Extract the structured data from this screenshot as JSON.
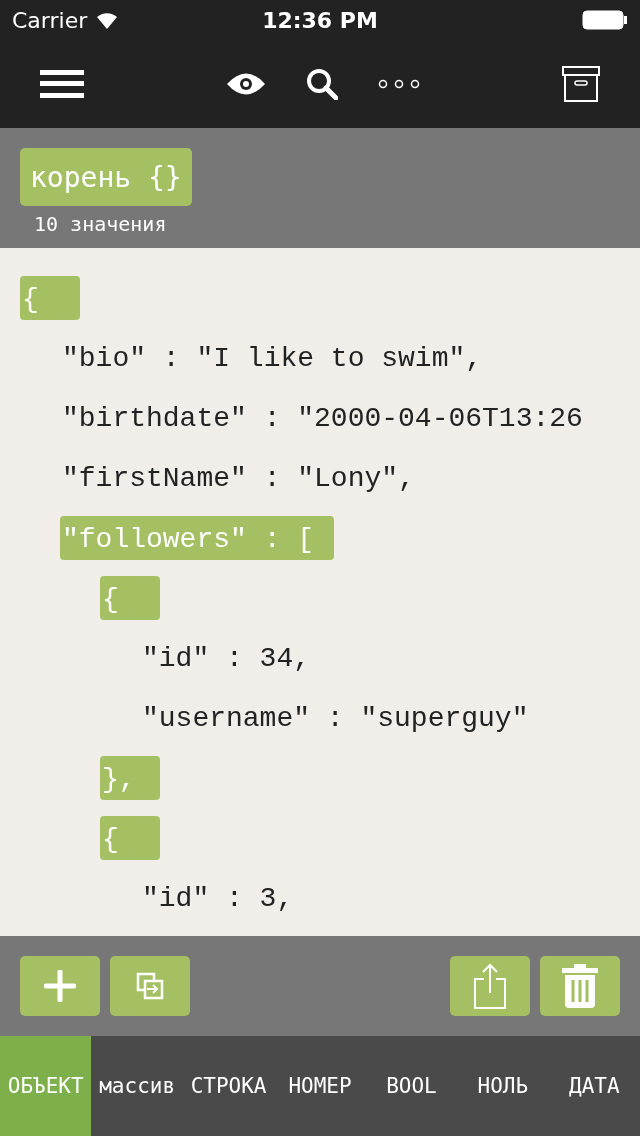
{
  "status_bar": {
    "carrier": "Carrier",
    "time": "12:36 PM"
  },
  "path": {
    "label": "корень {}",
    "count": "10 значения"
  },
  "lines": [
    {
      "text": "{",
      "selected": true,
      "children": [
        {
          "text": "\"bio\" : \"I like to swim\",",
          "selected": false
        },
        {
          "text": "\"birthdate\" : \"2000-04-06T13:26",
          "selected": false
        },
        {
          "text": "\"firstName\" : \"Lony\",",
          "selected": false
        },
        {
          "text": "\"followers\" : [",
          "selected": true,
          "children": [
            {
              "text": "{",
              "selected": true,
              "children": [
                {
                  "text": "\"id\" : 34,",
                  "selected": false
                },
                {
                  "text": "\"username\" : \"superguy\"",
                  "selected": false
                }
              ]
            },
            {
              "text": "},",
              "selected": true
            },
            {
              "text": "{",
              "selected": true,
              "children": [
                {
                  "text": "\"id\" : 3,",
                  "selected": false
                }
              ]
            }
          ]
        }
      ]
    }
  ],
  "type_tabs": [
    {
      "label": "ОБЪЕКТ",
      "selected": true
    },
    {
      "label": "массив",
      "selected": false
    },
    {
      "label": "СТРОКА",
      "selected": false
    },
    {
      "label": "НОМЕР",
      "selected": false
    },
    {
      "label": "BOOL",
      "selected": false
    },
    {
      "label": "НОЛЬ",
      "selected": false
    },
    {
      "label": "ДАТА",
      "selected": false
    }
  ]
}
